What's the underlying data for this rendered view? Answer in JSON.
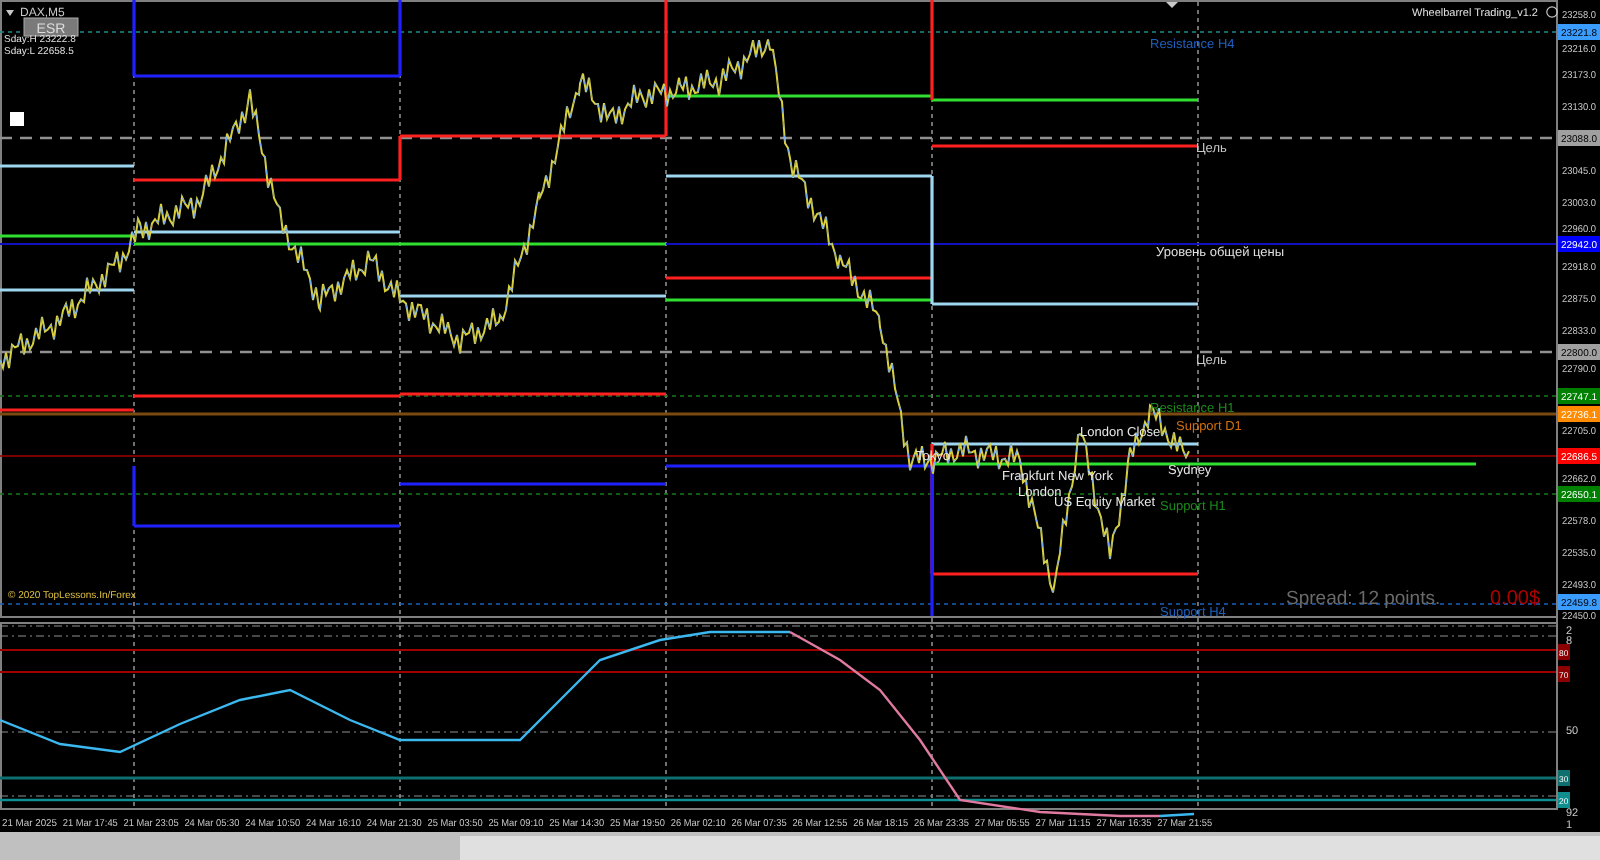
{
  "chart": {
    "symbol": "DAX,M5",
    "esr_button": "ESR",
    "info": [
      "Sday:H 23222.8",
      "Sday:L 22658.5"
    ],
    "indicator_title": "Wheelbarrel Trading_v1.2",
    "copyright": "© 2020 TopLessons.In/Forex",
    "price_axis": [
      "23258.0",
      "23216.0",
      "23173.0",
      "23130.0",
      "23045.0",
      "23003.0",
      "22960.0",
      "22918.0",
      "22875.0",
      "22833.0",
      "22790.0",
      "22705.0",
      "22662.0",
      "22578.0",
      "22535.0",
      "22493.0",
      "22450.0"
    ],
    "price_tags": [
      {
        "text": "23221.8",
        "color": "#3a9cff"
      },
      {
        "text": "23088.0",
        "color": "#a0a0a0"
      },
      {
        "text": "22942.0",
        "color": "#0000ff"
      },
      {
        "text": "22800.0",
        "color": "#a0a0a0"
      },
      {
        "text": "22747.1",
        "color": "#008000"
      },
      {
        "text": "22736.1",
        "color": "#ff8c00"
      },
      {
        "text": "22686.5",
        "color": "#ff0000"
      },
      {
        "text": "22650.1",
        "color": "#008000"
      },
      {
        "text": "22459.8",
        "color": "#3a9cff"
      }
    ],
    "level_labels": [
      {
        "text": "Resistance H4",
        "color": "#1e60c0"
      },
      {
        "text": "Цель",
        "color": "#c8c8c8"
      },
      {
        "text": "Уровень общей цены",
        "color": "#e0e0e0"
      },
      {
        "text": "Цель",
        "color": "#c8c8c8"
      },
      {
        "text": "Resistance H1",
        "color": "#1a8a1a"
      },
      {
        "text": "Support D1",
        "color": "#d07010"
      },
      {
        "text": "Support H1",
        "color": "#1a8a1a"
      },
      {
        "text": "Support H4",
        "color": "#1e60c0"
      }
    ],
    "session_labels": [
      "Tokyo",
      "London Close",
      "Frankfurt",
      "New York",
      "London",
      "US Equity Market",
      "Sydney"
    ],
    "spread": "Spread: 12 points.",
    "profit": "0.00$"
  },
  "oscillator": {
    "axis": [
      "2",
      "8",
      "50",
      "92",
      "1"
    ],
    "tags": [
      {
        "text": "80",
        "color": "#8b0000"
      },
      {
        "text": "70",
        "color": "#8b0000"
      },
      {
        "text": "30",
        "color": "#0f6e6e"
      },
      {
        "text": "20",
        "color": "#0f8e8e"
      }
    ]
  },
  "time_axis": [
    "21 Mar 2025",
    "21 Mar 17:45",
    "21 Mar 23:05",
    "24 Mar 05:30",
    "24 Mar 10:50",
    "24 Mar 16:10",
    "24 Mar 21:30",
    "25 Mar 03:50",
    "25 Mar 09:10",
    "25 Mar 14:30",
    "25 Mar 19:50",
    "26 Mar 02:10",
    "26 Mar 07:35",
    "26 Mar 12:55",
    "26 Mar 18:15",
    "26 Mar 23:35",
    "27 Mar 05:55",
    "27 Mar 11:15",
    "27 Mar 16:35",
    "27 Mar 21:55"
  ]
}
